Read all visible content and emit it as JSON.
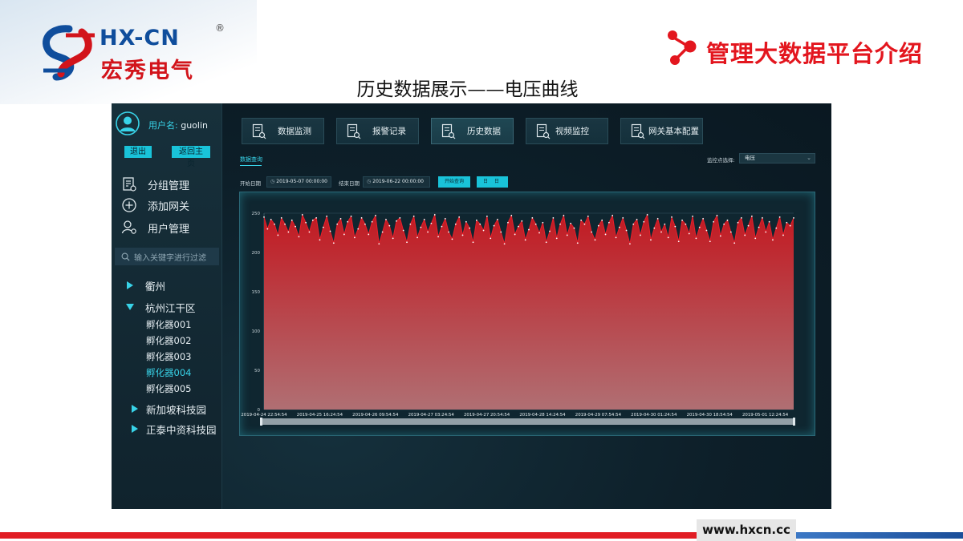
{
  "slide": {
    "logo_latin": "HX-CN",
    "logo_cn": "宏秀电气",
    "logo_reg": "®",
    "title": "管理大数据平台介绍",
    "subtitle": "历史数据展示——电压曲线",
    "footer_url": "www.hxcn.cc",
    "colors": {
      "brand_red": "#e11d24",
      "brand_blue": "#0f4d9c",
      "accent_cyan": "#38d3e8"
    }
  },
  "app": {
    "user": {
      "label": "用户名:",
      "name": "guolin"
    },
    "logout_label": "退出",
    "home_label": "返回主页",
    "menu": [
      {
        "label": "分组管理",
        "icon": "group-manage-icon"
      },
      {
        "label": "添加网关",
        "icon": "add-gateway-icon"
      },
      {
        "label": "用户管理",
        "icon": "user-manage-icon"
      }
    ],
    "search_placeholder": "输入关键字进行过滤",
    "tree": [
      {
        "label": "衢州",
        "expanded": false
      },
      {
        "label": "杭州江干区",
        "expanded": true,
        "children": [
          "孵化器001",
          "孵化器002",
          "孵化器003",
          "孵化器004",
          "孵化器005"
        ],
        "active_child": "孵化器004"
      },
      {
        "label": "新加坡科技园",
        "expanded": false
      },
      {
        "label": "正泰中资科技园",
        "expanded": false
      }
    ],
    "nav": [
      {
        "label": "数据监测",
        "active": false
      },
      {
        "label": "报警记录",
        "active": false
      },
      {
        "label": "历史数据",
        "active": true
      },
      {
        "label": "视频监控",
        "active": false
      },
      {
        "label": "网关基本配置",
        "active": false
      }
    ],
    "query_tab": "数据查询",
    "monitor_label": "监控点选择:",
    "monitor_value": "电压",
    "start_label": "开始日期",
    "start_value": "2019-05-07 00:00:00",
    "end_label": "结束日期",
    "end_value": "2019-06-22 00:00:00",
    "query_button": "开始查询",
    "reset_button": "日 日"
  },
  "chart_data": {
    "type": "area",
    "ylim": [
      0,
      250
    ],
    "yticks": [
      "0",
      "50",
      "100",
      "150",
      "200",
      "250"
    ],
    "xticks": [
      "2019-04-24 22:54:54",
      "2019-04-25 16:24:54",
      "2019-04-26 09:54:54",
      "2019-04-27 03:24:54",
      "2019-04-27 20:54:54",
      "2019-04-28 14:24:54",
      "2019-04-29 07:54:54",
      "2019-04-30 01:24:54",
      "2019-04-30 18:54:54",
      "2019-05-01 12:24:54"
    ],
    "series": [
      {
        "values": [
          245,
          230,
          242,
          236,
          222,
          244,
          236,
          226,
          241,
          233,
          220,
          248,
          238,
          226,
          241,
          244,
          216,
          232,
          246,
          227,
          212,
          236,
          243,
          223,
          239,
          246,
          219,
          230,
          244,
          236,
          223,
          239,
          247,
          211,
          226,
          242,
          234,
          218,
          240,
          244,
          228,
          213,
          236,
          246,
          219,
          232,
          242,
          226,
          237,
          248,
          220,
          233,
          243,
          226,
          217,
          236,
          245,
          222,
          239,
          231,
          213,
          241,
          236,
          228,
          246,
          218,
          234,
          242,
          226,
          211,
          238,
          247,
          223,
          233,
          240,
          216,
          229,
          244,
          236,
          225,
          238,
          213,
          227,
          244,
          218,
          236,
          247,
          222,
          237,
          231,
          212,
          241,
          236,
          246,
          226,
          216,
          234,
          241,
          223,
          238,
          247,
          219,
          232,
          244,
          228,
          211,
          236,
          242,
          222,
          239,
          248,
          216,
          231,
          243,
          226,
          236,
          219,
          245,
          233,
          214,
          241,
          236,
          224,
          246,
          218,
          232,
          243,
          228,
          214,
          239,
          247,
          221,
          236,
          241,
          226,
          212,
          238,
          244,
          222,
          234,
          246,
          218,
          232,
          244,
          226,
          239,
          216,
          231,
          245,
          222,
          238,
          234,
          244
        ]
      }
    ],
    "line_color": "#e8202b",
    "fill_top": "#c21a22",
    "fill_bottom": "#b06f73",
    "grid": true
  }
}
